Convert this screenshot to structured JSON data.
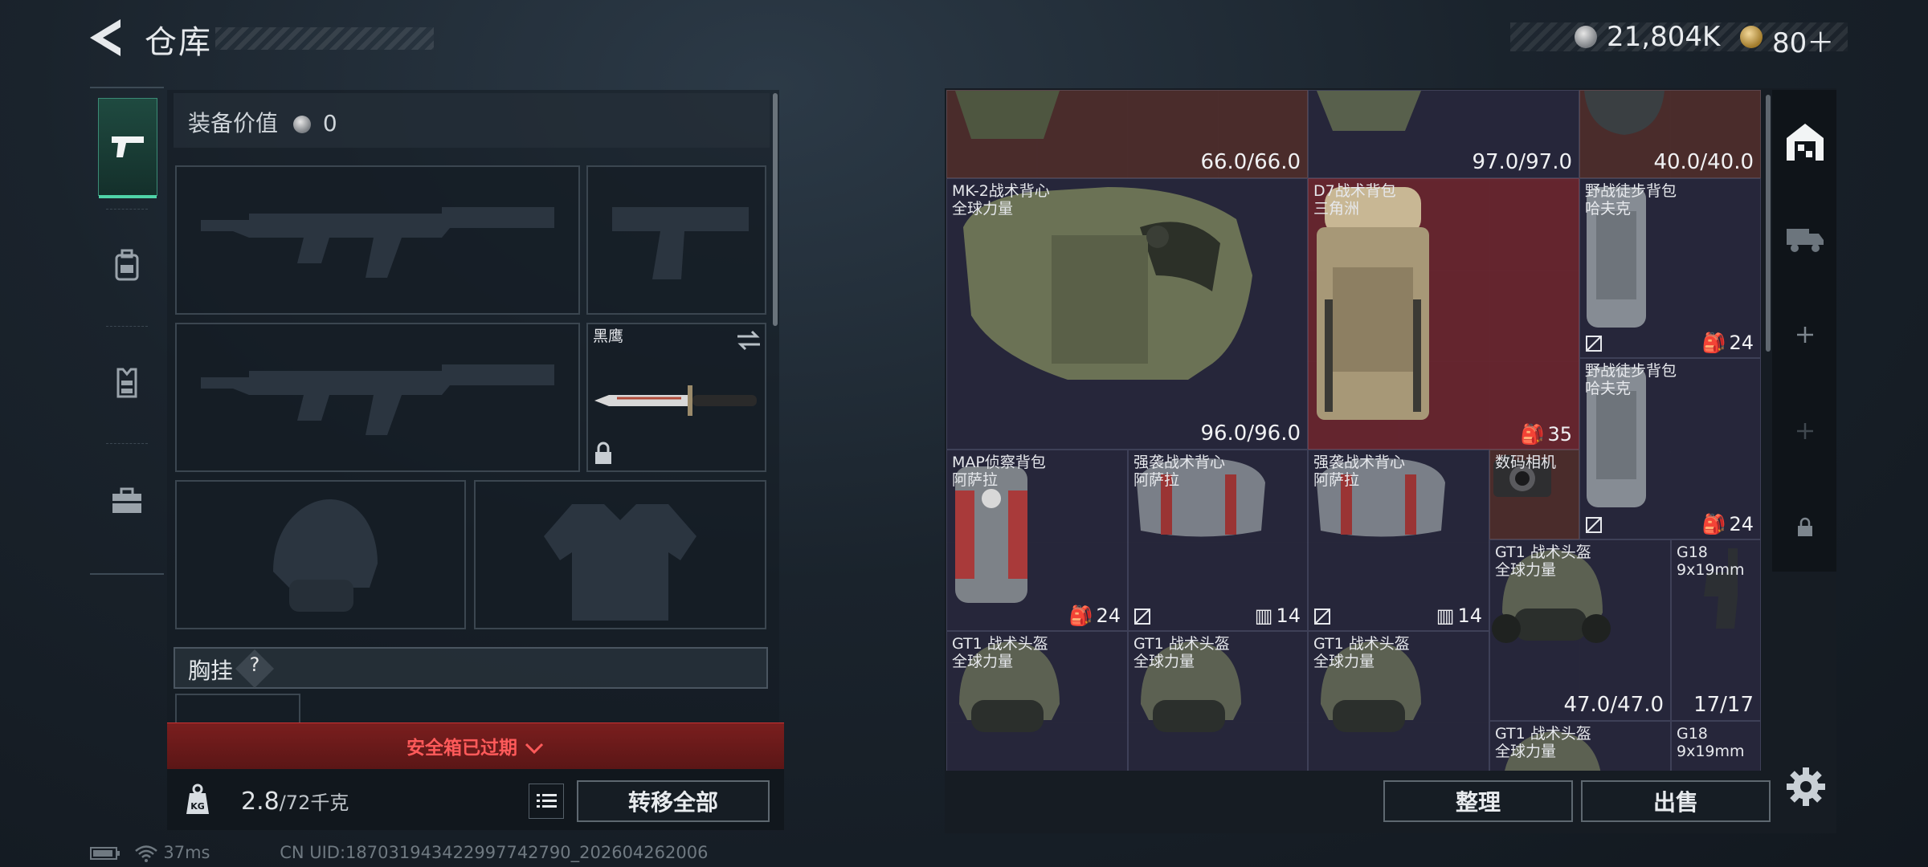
{
  "header": {
    "title": "仓库",
    "currency_amount": "21,804K",
    "ticket_amount": "80＋"
  },
  "tabs": [
    "gun-icon",
    "backpack-icon",
    "vest-icon",
    "toolbox-icon"
  ],
  "loadout": {
    "value_label": "装备价值",
    "value_amount": "0",
    "knife_name": "黑鹰",
    "chest_label": "胸挂",
    "chest_help": "?",
    "expired_text": "安全箱已过期",
    "weight_value": "2.8",
    "weight_max": "/72千克",
    "transfer_all": "转移全部"
  },
  "status": {
    "ping": "37ms",
    "uid": "CN UID:187031943422997742790_202604262006"
  },
  "storage": {
    "items": [
      {
        "name": "",
        "sub": "",
        "value": "66.0/66.0"
      },
      {
        "name": "",
        "sub": "",
        "value": "97.0/97.0"
      },
      {
        "name": "",
        "sub": "",
        "value": "40.0/40.0"
      },
      {
        "name": "MK-2战术背心",
        "sub": "全球力量",
        "value": "96.0/96.0"
      },
      {
        "name": "D7战术背包",
        "sub": "三角洲",
        "value": "35"
      },
      {
        "name": "野战徒步背包",
        "sub": "哈夫克",
        "value": "24"
      },
      {
        "name": "野战徒步背包",
        "sub": "哈夫克",
        "value": "24"
      },
      {
        "name": "MAP侦察背包",
        "sub": "阿萨拉",
        "value": "24"
      },
      {
        "name": "强袭战术背心",
        "sub": "阿萨拉",
        "value": "14"
      },
      {
        "name": "强袭战术背心",
        "sub": "阿萨拉",
        "value": "14"
      },
      {
        "name": "数码相机",
        "sub": "",
        "value": ""
      },
      {
        "name": "GT1 战术头盔",
        "sub": "全球力量",
        "value": "47.0/47.0"
      },
      {
        "name": "G18",
        "sub": "9x19mm",
        "value": "17/17"
      },
      {
        "name": "GT1 战术头盔",
        "sub": "全球力量",
        "value": ""
      },
      {
        "name": "GT1 战术头盔",
        "sub": "全球力量",
        "value": ""
      },
      {
        "name": "GT1 战术头盔",
        "sub": "全球力量",
        "value": ""
      },
      {
        "name": "GT1 战术头盔",
        "sub": "全球力量",
        "value": ""
      },
      {
        "name": "G18",
        "sub": "9x19mm",
        "value": ""
      }
    ],
    "sort_label": "整理",
    "sell_label": "出售"
  },
  "colors": {
    "accent": "#4fd3a8",
    "warning": "#ff5a5a"
  }
}
